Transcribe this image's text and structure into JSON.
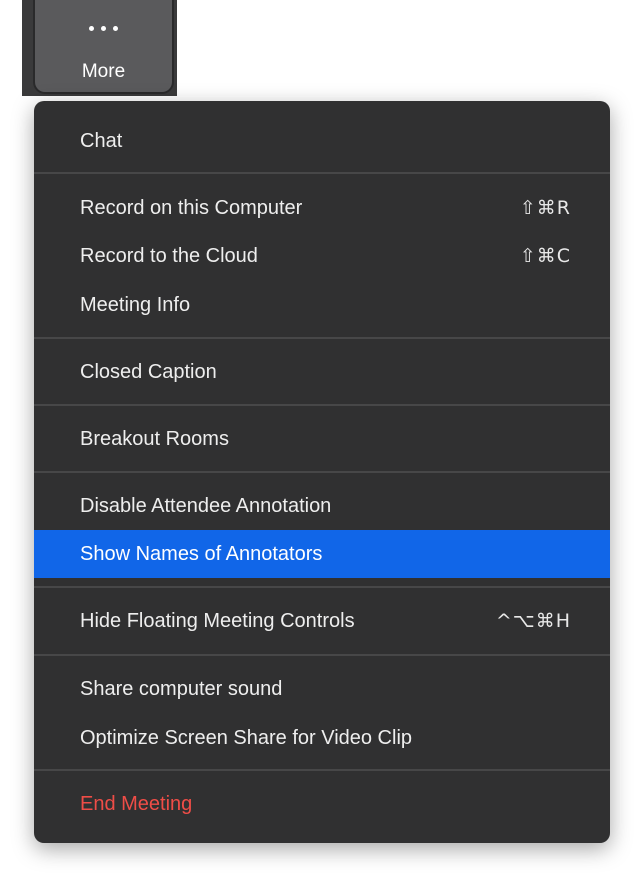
{
  "toolbar": {
    "more_label": "More"
  },
  "menu": {
    "chat": "Chat",
    "record_computer": "Record on this Computer",
    "record_computer_shortcut": "⇧⌘R",
    "record_cloud": "Record to the Cloud",
    "record_cloud_shortcut": "⇧⌘C",
    "meeting_info": "Meeting Info",
    "closed_caption": "Closed Caption",
    "breakout_rooms": "Breakout Rooms",
    "disable_annotation": "Disable Attendee Annotation",
    "show_annotators": "Show Names of Annotators",
    "hide_controls": "Hide Floating Meeting Controls",
    "hide_controls_shortcut": "^⌥⌘H",
    "share_sound": "Share computer sound",
    "optimize_share": "Optimize Screen Share for Video Clip",
    "end_meeting": "End Meeting"
  },
  "colors": {
    "menu_background": "#303031",
    "selected_highlight": "#1166e8",
    "danger_text": "#ef4d47",
    "more_button": "#5a5a5c"
  },
  "icons": {
    "more": "ellipsis-icon"
  }
}
